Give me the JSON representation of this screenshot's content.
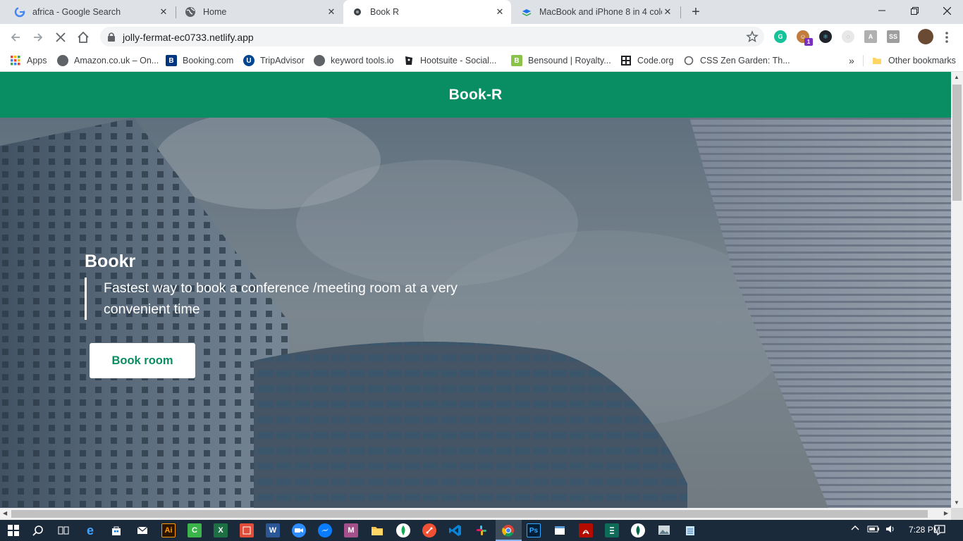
{
  "browser": {
    "tabs": [
      {
        "title": "africa - Google Search",
        "icon": "google-icon",
        "active": false
      },
      {
        "title": "Home",
        "icon": "globe-icon",
        "active": false
      },
      {
        "title": "Book R",
        "icon": "page-icon",
        "active": true
      },
      {
        "title": "MacBook and iPhone 8 in 4 colors",
        "icon": "layers-icon",
        "active": false
      }
    ],
    "url": "jolly-fermat-ec0733.netlify.app",
    "extension_badge": "1",
    "ext_ss_label": "SS"
  },
  "bookmarks": {
    "items": [
      {
        "label": "Apps",
        "icon": "apps-grid-icon"
      },
      {
        "label": "Amazon.co.uk – On...",
        "icon": "globe-icon"
      },
      {
        "label": "Booking.com",
        "icon": "booking-icon",
        "glyph": "B"
      },
      {
        "label": "TripAdvisor",
        "icon": "tripadvisor-icon",
        "glyph": "U"
      },
      {
        "label": "keyword tools.io",
        "icon": "globe-icon"
      },
      {
        "label": "Hootsuite - Social...",
        "icon": "hootsuite-icon"
      },
      {
        "label": "Bensound | Royalty...",
        "icon": "bensound-icon",
        "glyph": "B"
      },
      {
        "label": "Code.org",
        "icon": "codeorg-icon"
      },
      {
        "label": "CSS Zen Garden: Th...",
        "icon": "zen-icon"
      }
    ],
    "overflow": "»",
    "other": "Other bookmarks"
  },
  "site": {
    "header_title": "Book-R",
    "hero_title": "Bookr",
    "hero_text": "Fastest way to book a conference /meeting room at a very convenient time",
    "cta_label": "Book room"
  },
  "taskbar": {
    "apps": [
      "start-icon",
      "search-icon",
      "task-view-icon",
      "edge-icon",
      "store-icon",
      "mail-icon",
      "illustrator-icon",
      "camtasia-icon",
      "excel-icon",
      "capture-icon",
      "word-icon",
      "zoom-icon",
      "messenger-icon",
      "m-app-icon",
      "file-explorer-icon",
      "mongodb-icon",
      "git-icon",
      "vscode-icon",
      "slack-icon",
      "chrome-icon",
      "photoshop-icon",
      "window-app-icon",
      "acrobat-icon",
      "editor-icon",
      "mongodb-compass-icon",
      "photos-icon",
      "notepad-icon"
    ],
    "labels": {
      "illustrator": "Ai",
      "camtasia": "C",
      "excel": "X",
      "word": "W",
      "m_app": "M",
      "photoshop": "Ps"
    },
    "time": "7:28 PM"
  },
  "colors": {
    "brand_green": "#098d62",
    "hero_text": "#ffffff"
  }
}
